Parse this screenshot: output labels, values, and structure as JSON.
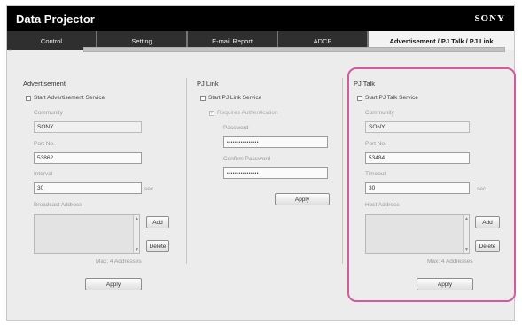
{
  "app": {
    "title": "Data Projector",
    "brand": "SONY"
  },
  "tabs": [
    "Control",
    "Setting",
    "E-mail Report",
    "ADCP",
    "Advertisement / PJ Talk / PJ Link"
  ],
  "scroll_marker": "•",
  "advertisement": {
    "title": "Advertisement",
    "start_label": "Start Advertisement Service",
    "community_label": "Community",
    "community_value": "SONY",
    "port_label": "Port No.",
    "port_value": "53862",
    "interval_label": "Interval",
    "interval_value": "30",
    "interval_unit": "sec.",
    "broadcast_label": "Broadcast Address",
    "add_label": "Add",
    "delete_label": "Delete",
    "max_note": "Max: 4 Addresses",
    "apply_label": "Apply"
  },
  "pjlink": {
    "title": "PJ Link",
    "start_label": "Start PJ Link Service",
    "requires_auth_label": "Requires Authentication",
    "requires_auth_mark": "✓",
    "password_label": "Password",
    "password_value": "••••••••••••••••",
    "confirm_label": "Confirm Password",
    "confirm_value": "••••••••••••••••",
    "apply_label": "Apply"
  },
  "pjtalk": {
    "title": "PJ Talk",
    "start_label": "Start PJ Talk Service",
    "community_label": "Community",
    "community_value": "SONY",
    "port_label": "Port No.",
    "port_value": "53484",
    "timeout_label": "Timeout",
    "timeout_value": "30",
    "timeout_unit": "sec.",
    "host_label": "Host Address",
    "add_label": "Add",
    "delete_label": "Delete",
    "max_note": "Max: 4 Addresses",
    "apply_label": "Apply"
  },
  "colors": {
    "highlight": "#d8589f",
    "titlebar": "#000000",
    "active_tab": "#f3f3f3"
  }
}
